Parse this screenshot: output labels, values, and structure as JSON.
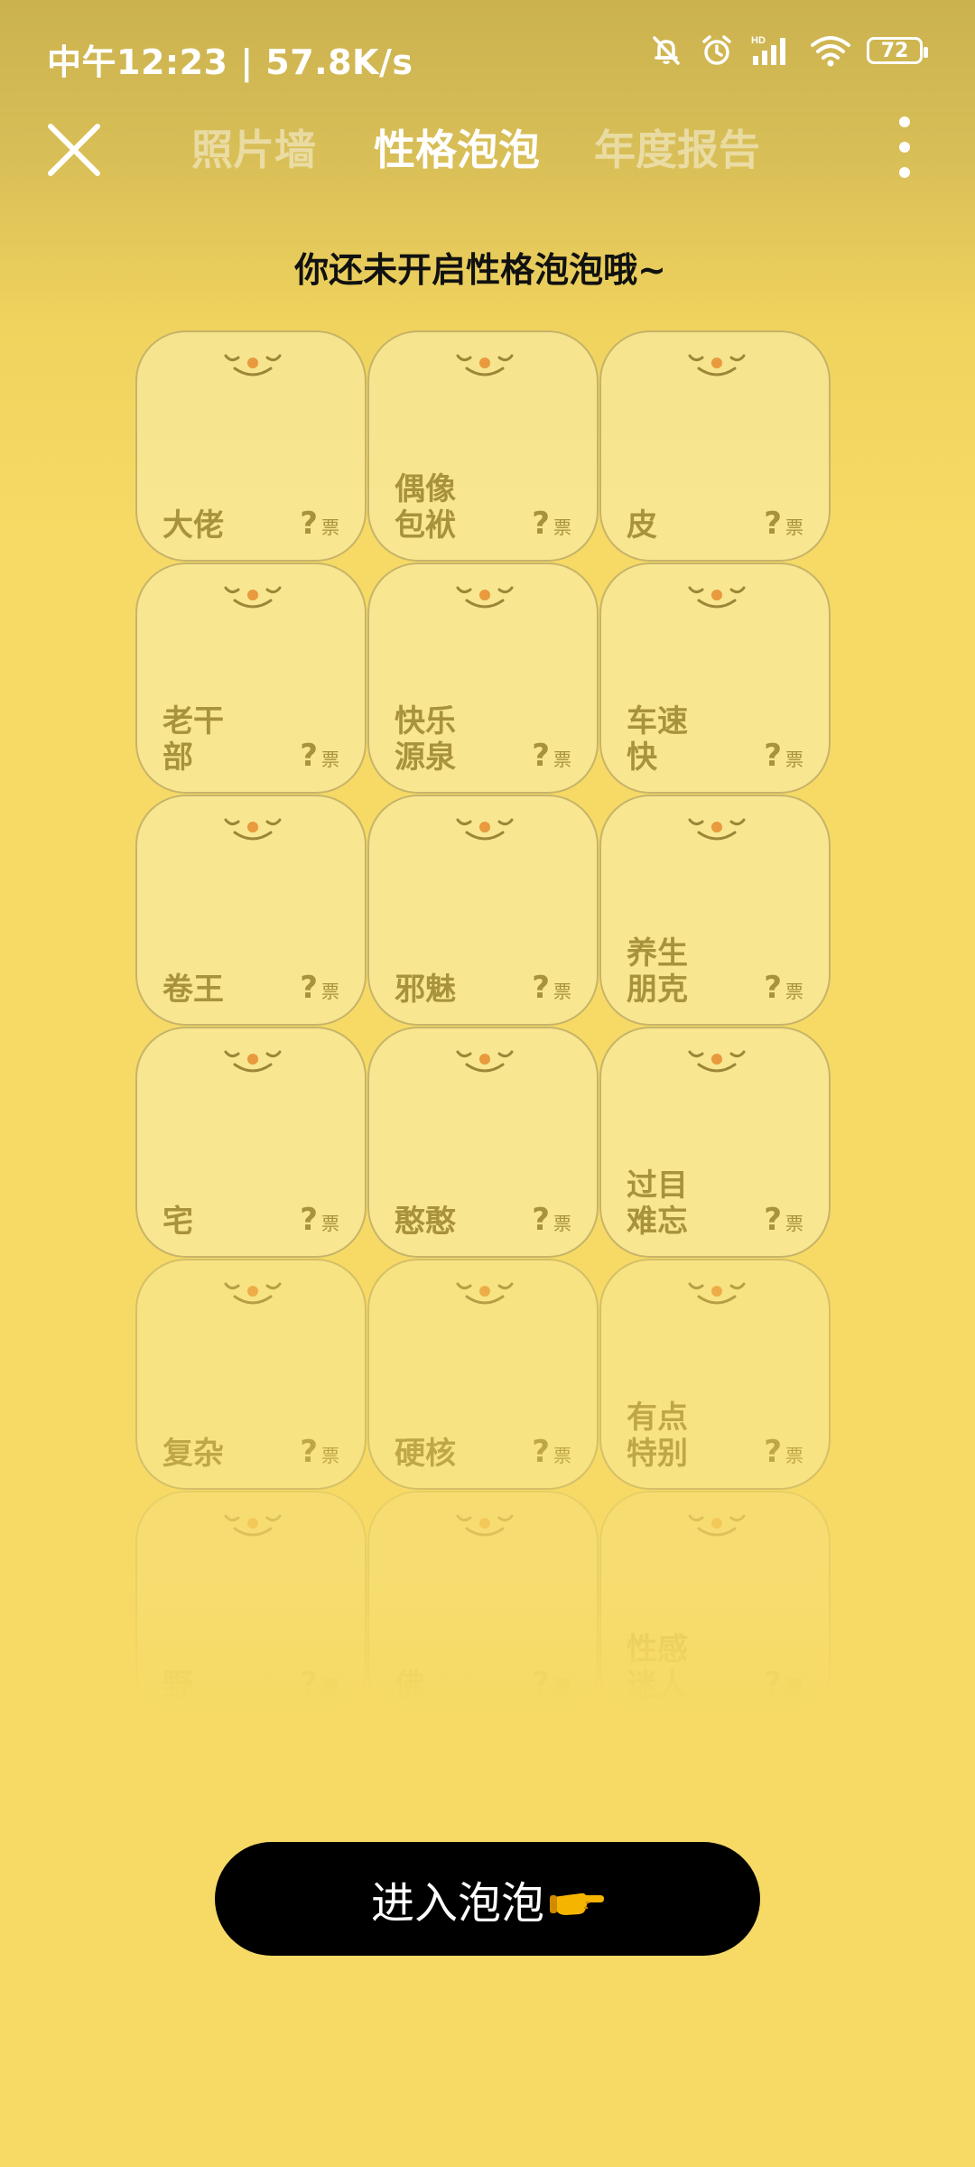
{
  "status_bar": {
    "time_speed": "中午12:23 | 57.8K/s",
    "battery": "72",
    "icons": [
      "mute-bell-icon",
      "alarm-icon",
      "hd-signal-icon",
      "wifi-icon",
      "battery-icon"
    ]
  },
  "header": {
    "tabs": [
      {
        "label": "照片墙",
        "active": false
      },
      {
        "label": "性格泡泡",
        "active": true
      },
      {
        "label": "年度报告",
        "active": false
      }
    ],
    "icons": {
      "close": "close-icon",
      "more": "more-vertical-icon"
    }
  },
  "notice": "你还未开启性格泡泡哦~",
  "bubbles": [
    {
      "name": "大佬",
      "votes": "?",
      "unit": "票"
    },
    {
      "name": "偶像包袱",
      "votes": "?",
      "unit": "票"
    },
    {
      "name": "皮",
      "votes": "?",
      "unit": "票"
    },
    {
      "name": "老干部",
      "votes": "?",
      "unit": "票"
    },
    {
      "name": "快乐源泉",
      "votes": "?",
      "unit": "票"
    },
    {
      "name": "车速快",
      "votes": "?",
      "unit": "票"
    },
    {
      "name": "卷王",
      "votes": "?",
      "unit": "票"
    },
    {
      "name": "邪魅",
      "votes": "?",
      "unit": "票"
    },
    {
      "name": "养生朋克",
      "votes": "?",
      "unit": "票"
    },
    {
      "name": "宅",
      "votes": "?",
      "unit": "票"
    },
    {
      "name": "憨憨",
      "votes": "?",
      "unit": "票"
    },
    {
      "name": "过目难忘",
      "votes": "?",
      "unit": "票"
    },
    {
      "name": "复杂",
      "votes": "?",
      "unit": "票"
    },
    {
      "name": "硬核",
      "votes": "?",
      "unit": "票"
    },
    {
      "name": "有点特别",
      "votes": "?",
      "unit": "票"
    },
    {
      "name": "野",
      "votes": "?",
      "unit": "票"
    },
    {
      "name": "佛",
      "votes": "?",
      "unit": "票"
    },
    {
      "name": "性感迷人",
      "votes": "?",
      "unit": "票"
    }
  ],
  "enter_button": {
    "label": "进入泡泡",
    "icon": "pointing-hand-icon"
  },
  "colors": {
    "background": "#f6da65",
    "header_bg": "#cbb24f",
    "card_text": "#a8923b",
    "button_bg": "#000000",
    "button_text": "#ffffff"
  }
}
